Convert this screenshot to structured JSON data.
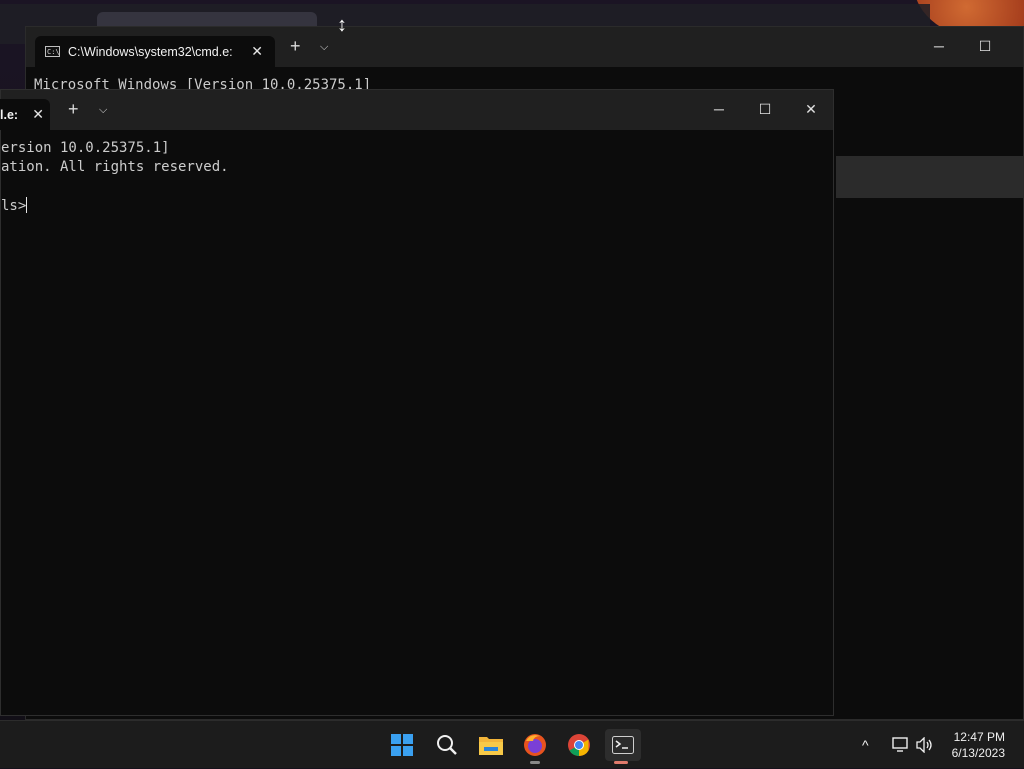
{
  "back_window": {
    "tab_title": "C:\\Windows\\system32\\cmd.e:",
    "lines": [
      "Microsoft Windows [Version 10.0.25375.1]"
    ]
  },
  "front_window": {
    "tab_title": "l.e:",
    "lines": [
      "ersion 10.0.25375.1]",
      "ation. All rights reserved.",
      "",
      "ls>"
    ]
  },
  "buttons": {
    "new_tab": "+",
    "dropdown": "⌵",
    "minimize": "─",
    "maximize": "☐",
    "close": "✕",
    "tab_close": "✕"
  },
  "taskbar": {
    "apps": [
      {
        "name": "start-icon"
      },
      {
        "name": "search-icon"
      },
      {
        "name": "file-explorer-icon"
      },
      {
        "name": "firefox-icon"
      },
      {
        "name": "chrome-icon"
      },
      {
        "name": "terminal-icon"
      }
    ],
    "tray": {
      "chevron": "^",
      "time": "12:47 PM",
      "date": "6/13/2023"
    }
  },
  "colors": {
    "terminal_bg": "#0c0c0c",
    "titlebar_bg": "#202020",
    "taskbar_bg": "#1c1c1c",
    "accent": "#e07a6c"
  }
}
